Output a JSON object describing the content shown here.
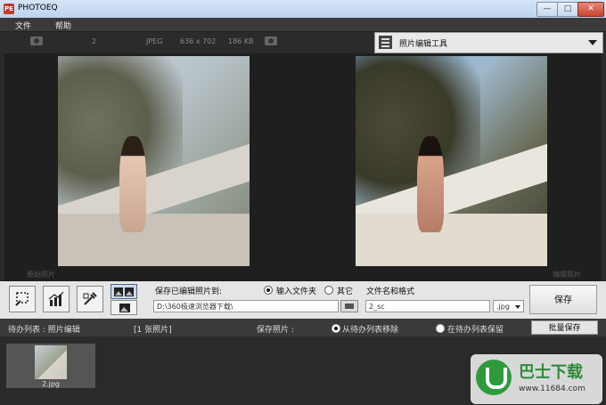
{
  "window": {
    "title": "PHOTOEQ",
    "app_icon": "PE",
    "min": "—",
    "max": "□",
    "close": "✕"
  },
  "menu": {
    "items": [
      "文件",
      "帮助"
    ]
  },
  "info": {
    "count": "2",
    "format": "JPEG",
    "dimensions": "636 x 702",
    "size": "186 KB"
  },
  "tools": {
    "dropdown_label": "照片编辑工具"
  },
  "viewer": {
    "original_caption": "原始照片",
    "edited_caption": "编辑照片"
  },
  "save": {
    "label": "保存已编辑照片到:",
    "option_input": "输入文件夹",
    "option_other": "其它",
    "path": "D:\\360极速浏览器下载\\",
    "filename_label": "文件名和格式",
    "filename": "2_sc",
    "extension": ".jpg",
    "save_button": "保存"
  },
  "queue": {
    "list_label": "待办列表 : 照片编辑",
    "count_label": "[1 张照片]",
    "save_photos_label": "保存照片 :",
    "remove_option": "从待办列表移除",
    "keep_option": "在待办列表保留",
    "batch_button": "批量保存",
    "items": [
      {
        "label": "2.jpg"
      }
    ]
  },
  "watermark": {
    "name": "巴士下载",
    "url": "www.11684.com"
  }
}
